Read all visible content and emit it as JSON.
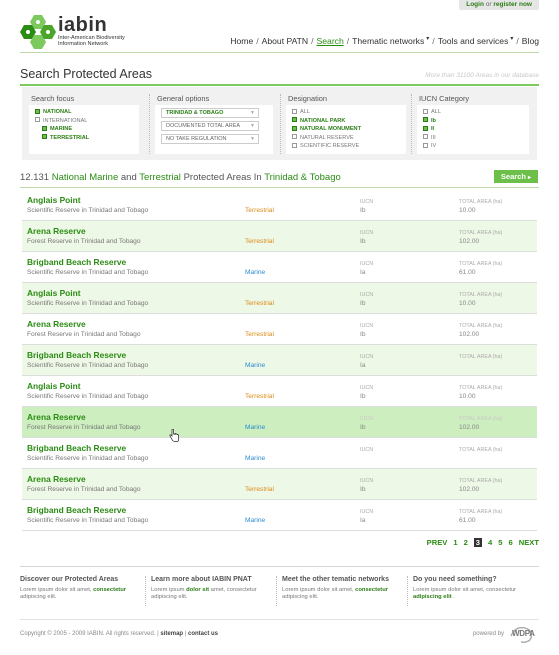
{
  "login": {
    "login_label": "Login",
    "or": "or",
    "register_label": "register now"
  },
  "brand": {
    "name": "iabin",
    "subtitle": "Inter-American Biodiversity Information Network"
  },
  "nav": [
    {
      "label": "Home",
      "active": false,
      "dropdown": false
    },
    {
      "label": "About PATN",
      "active": false,
      "dropdown": false
    },
    {
      "label": "Search",
      "active": true,
      "dropdown": false
    },
    {
      "label": "Thematic networks",
      "active": false,
      "dropdown": true
    },
    {
      "label": "Tools and services",
      "active": false,
      "dropdown": true
    },
    {
      "label": "Blog",
      "active": false,
      "dropdown": false
    }
  ],
  "page": {
    "title": "Search Protected Areas",
    "subtitle": "More than 31100 Areas in our database"
  },
  "filters": {
    "focus": {
      "heading": "Search focus",
      "options": [
        {
          "label": "NATIONAL",
          "checked": true,
          "indent": false
        },
        {
          "label": "INTERNATIONAL",
          "checked": false,
          "indent": false
        },
        {
          "label": "MARINE",
          "checked": true,
          "indent": true
        },
        {
          "label": "TERRESTRIAL",
          "checked": true,
          "indent": true
        }
      ]
    },
    "general": {
      "heading": "General options",
      "selects": [
        {
          "value": "TRINIDAD & TOBAGO",
          "highlight": true
        },
        {
          "value": "DOCUMENTED TOTAL AREA",
          "highlight": false
        },
        {
          "value": "NO TAKE REGULATION",
          "highlight": false
        }
      ]
    },
    "designation": {
      "heading": "Designation",
      "options": [
        {
          "label": "ALL",
          "checked": false
        },
        {
          "label": "NATIONAL PARK",
          "checked": true
        },
        {
          "label": "NATURAL MONUMENT",
          "checked": true
        },
        {
          "label": "NATURAL RESERVE",
          "checked": false
        },
        {
          "label": "SCIENTIFIC RESERVE",
          "checked": false
        }
      ]
    },
    "iucn": {
      "heading": "IUCN Category",
      "options": [
        {
          "label": "ALL",
          "checked": false
        },
        {
          "label": "Ib",
          "checked": true
        },
        {
          "label": "II",
          "checked": true
        },
        {
          "label": "III",
          "checked": false
        },
        {
          "label": "IV",
          "checked": false
        }
      ]
    }
  },
  "results": {
    "count": "12.131",
    "w1": "National Marine",
    "and": "and",
    "w2": "Terrestrial",
    "mid": "Protected Areas In",
    "place": "Trinidad & Tobago",
    "search_label": "Search",
    "iucn_label": "IUCN",
    "area_label": "TOTAL AREA (ha)",
    "rows": [
      {
        "name": "Anglais Point",
        "type": "Scientific Reserve in Trinidad and Tobago",
        "eco": "Terrestrial",
        "iucn": "Ib",
        "area": "10.00",
        "style": "normal"
      },
      {
        "name": "Arena Reserve",
        "type": "Forest Reserve in Trinidad and Tobago",
        "eco": "Terrestrial",
        "iucn": "Ib",
        "area": "102.00",
        "style": "alt"
      },
      {
        "name": "Brigband Beach Reserve",
        "type": "Scientific Reserve in Trinidad and Tobago",
        "eco": "Marine",
        "iucn": "Ia",
        "area": "61.00",
        "style": "normal"
      },
      {
        "name": "Anglais Point",
        "type": "Scientific Reserve in Trinidad and Tobago",
        "eco": "Terrestrial",
        "iucn": "Ib",
        "area": "10.00",
        "style": "alt"
      },
      {
        "name": "Arena Reserve",
        "type": "Forest Reserve in Trinidad and Tobago",
        "eco": "Terrestrial",
        "iucn": "Ib",
        "area": "102.00",
        "style": "normal"
      },
      {
        "name": "Brigband Beach Reserve",
        "type": "Scientific Reserve in Trinidad and Tobago",
        "eco": "Marine",
        "iucn": "Ia",
        "area": "",
        "style": "alt"
      },
      {
        "name": "Anglais Point",
        "type": "Scientific Reserve in Trinidad and Tobago",
        "eco": "Terrestrial",
        "iucn": "Ib",
        "area": "10.00",
        "style": "normal"
      },
      {
        "name": "Arena Reserve",
        "type": "Forest Reserve in Trinidad and Tobago",
        "eco": "Marine",
        "iucn": "Ib",
        "area": "102.00",
        "style": "hl"
      },
      {
        "name": "Brigband Beach Reserve",
        "type": "Scientific Reserve in Trinidad and Tobago",
        "eco": "Marine",
        "iucn": "",
        "area": "",
        "style": "normal"
      },
      {
        "name": "Arena Reserve",
        "type": "Forest Reserve in Trinidad and Tobago",
        "eco": "Terrestrial",
        "iucn": "Ib",
        "area": "102.00",
        "style": "alt"
      },
      {
        "name": "Brigband Beach Reserve",
        "type": "Scientific Reserve in Trinidad and Tobago",
        "eco": "Marine",
        "iucn": "Ia",
        "area": "61.00",
        "style": "normal"
      }
    ]
  },
  "pager": {
    "prev": "PREV",
    "pages": [
      "1",
      "2",
      "3",
      "4",
      "5",
      "6"
    ],
    "current": "3",
    "next": "NEXT"
  },
  "footer": {
    "cols": [
      {
        "heading": "Discover our Protected Areas",
        "text1": "Lorem ipsum dolor sit amet,",
        "link": "consectetur",
        "text2": "adipiscing elit."
      },
      {
        "heading": "Learn more about IABIN PNAT",
        "text1": "Lorem ipsum",
        "link": "dolor sit",
        "text2": "amet, consectetur adipiscing elit."
      },
      {
        "heading": "Meet the other tematic networks",
        "text1": "Lorem ipsum dolor sit amet,",
        "link": "consectetur",
        "text2": "adipiscing elit."
      },
      {
        "heading": "Do you need something?",
        "text1": "Lorem ipsum dolor sit amet, consectetur",
        "link": "adipiscing elit",
        "text2": "."
      }
    ],
    "copyright": "Copyright © 2005 - 2009 IABIN. All rights reserved.",
    "sitemap": "sitemap",
    "contact": "contact us",
    "powered_by": "powered by",
    "wdpa": "WDPA"
  },
  "colors": {
    "accent": "#2a8c14",
    "accent_light": "#6cc04a",
    "terrestrial": "#d98a14",
    "marine": "#2a8ad0"
  }
}
